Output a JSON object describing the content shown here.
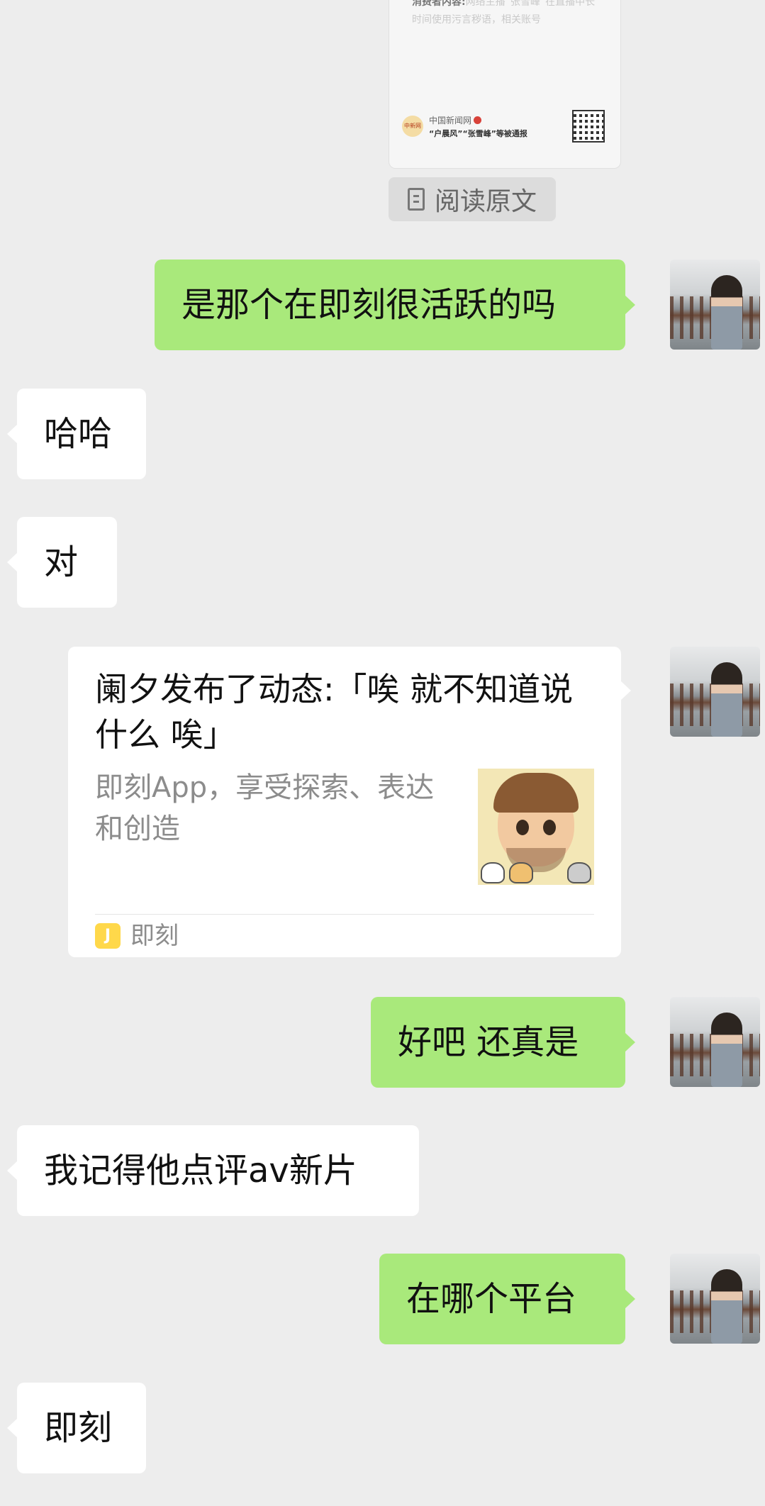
{
  "article_card": {
    "snippet_bold": "消费者内容:",
    "snippet_rest": "网络主播“张雪峰”在直播中长时间使用污言秽语，相关账号",
    "source_logo_text": "中新网",
    "source_name": "中国新闻网",
    "source_headline": "“户晨风”“张雪峰”等被通报"
  },
  "read_original": {
    "label": "阅读原文"
  },
  "messages": [
    {
      "side": "right",
      "text": "是那个在即刻很活跃的吗"
    },
    {
      "side": "left",
      "text": "哈哈"
    },
    {
      "side": "left",
      "text": "对"
    },
    {
      "side": "right",
      "text": "好吧 还真是"
    },
    {
      "side": "left",
      "text": "我记得他点评av新片"
    },
    {
      "side": "right",
      "text": "在哪个平台"
    },
    {
      "side": "left",
      "text": "即刻"
    }
  ],
  "share_card": {
    "title": "阑夕发布了动态:「唉 就不知道说什么 唉」",
    "description": "即刻App，享受探索、表达和创造",
    "app_icon_letter": "J",
    "app_name": "即刻"
  },
  "colors": {
    "background": "#ededed",
    "outgoing_bubble": "#a9e97b",
    "incoming_bubble": "#ffffff",
    "app_icon": "#ffd84a"
  }
}
